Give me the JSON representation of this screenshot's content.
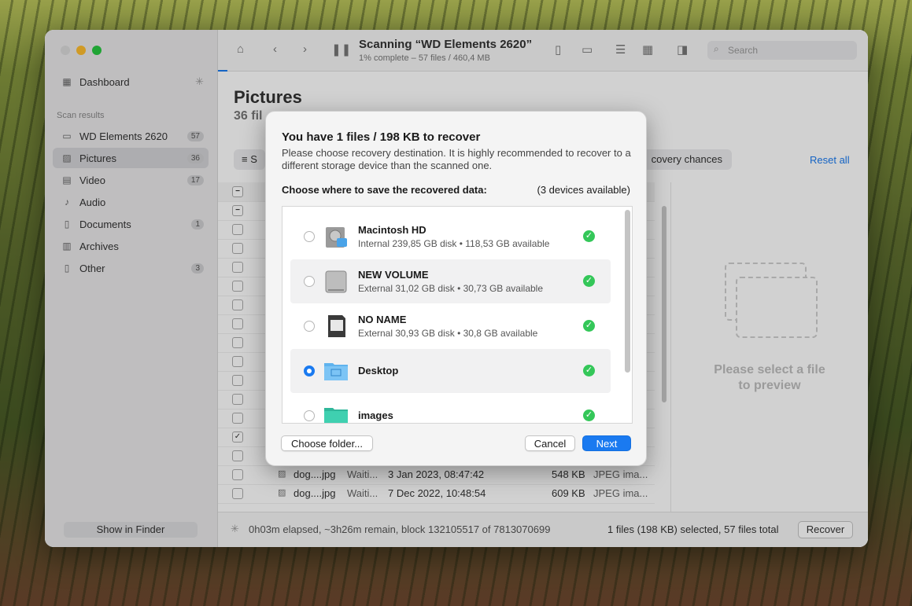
{
  "window": {
    "scan_title": "Scanning “WD Elements 2620”",
    "scan_subtitle": "1% complete – 57 files / 460,4 MB",
    "search_placeholder": "Search"
  },
  "sidebar": {
    "dashboard": "Dashboard",
    "section": "Scan results",
    "items": [
      {
        "label": "WD Elements 2620",
        "count": "57"
      },
      {
        "label": "Pictures",
        "count": "36"
      },
      {
        "label": "Video",
        "count": "17"
      },
      {
        "label": "Audio",
        "count": ""
      },
      {
        "label": "Documents",
        "count": "1"
      },
      {
        "label": "Archives",
        "count": ""
      },
      {
        "label": "Other",
        "count": "3"
      }
    ],
    "show_in_finder": "Show in Finder"
  },
  "main": {
    "heading": "Pictures",
    "subheading": "36 fil",
    "filter_partial": "S",
    "recovery_chances": "covery chances",
    "reset_all": "Reset all",
    "preview_text_1": "Please select a file",
    "preview_text_2": "to preview",
    "rows": [
      {
        "name": "dog....jpg",
        "status": "Waiti...",
        "date": "3 Jan 2023, 08:47:42",
        "size": "548 KB",
        "kind": "JPEG ima..."
      },
      {
        "name": "dog....jpg",
        "status": "Waiti...",
        "date": "7 Dec 2022, 10:48:54",
        "size": "609 KB",
        "kind": "JPEG ima..."
      }
    ]
  },
  "status_bar": {
    "elapsed": "0h03m elapsed, ~3h26m remain, block 132105517 of 7813070699",
    "selection": "1 files (198 KB) selected, 57 files total",
    "recover": "Recover"
  },
  "dialog": {
    "title": "You have 1 files / 198 KB to recover",
    "description": "Please choose recovery destination. It is highly recommended to recover to a different storage device than the scanned one.",
    "choose_label": "Choose where to save the recovered data:",
    "devices_available": "(3 devices available)",
    "devices": [
      {
        "name": "Macintosh HD",
        "info": "Internal 239,85 GB disk • 118,53 GB available"
      },
      {
        "name": "NEW VOLUME",
        "info": "External 31,02 GB disk • 30,73 GB available"
      },
      {
        "name": "NO NAME",
        "info": "External 30,93 GB disk • 30,8 GB available"
      },
      {
        "name": "Desktop",
        "info": ""
      },
      {
        "name": "images",
        "info": ""
      }
    ],
    "choose_folder": "Choose folder...",
    "cancel": "Cancel",
    "next": "Next"
  },
  "colors": {
    "accent": "#1a7af0",
    "ok": "#34c759"
  }
}
